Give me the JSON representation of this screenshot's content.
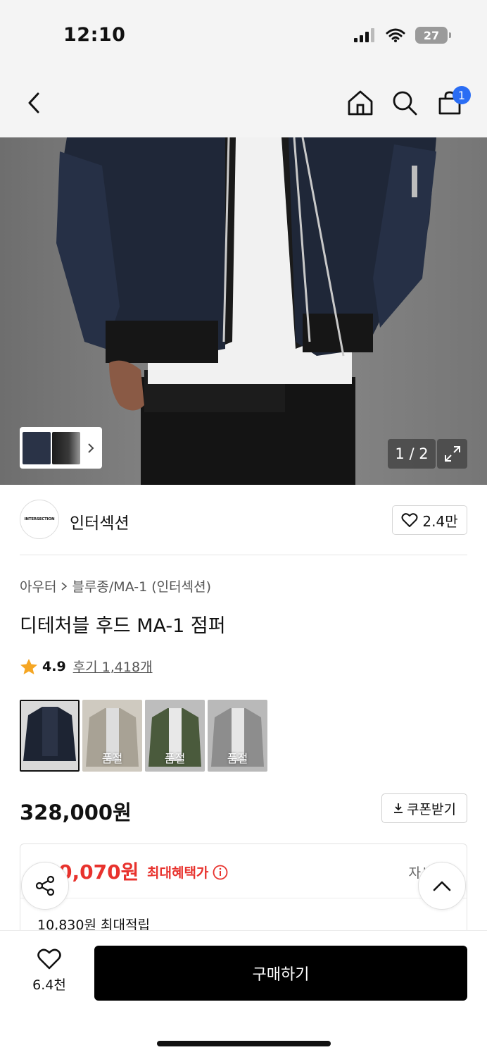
{
  "status": {
    "time": "12:10",
    "battery": "27"
  },
  "nav": {
    "cart_count": "1"
  },
  "hero": {
    "page_counter": "1 / 2"
  },
  "brand": {
    "logo_text": "INTERSECTION",
    "name": "인터섹션",
    "likes": "2.4만"
  },
  "breadcrumb": {
    "category": "아우터",
    "subcategory": "블루종/MA-1 (인터섹션)"
  },
  "product": {
    "title": "디테처블 후드 MA-1 점퍼",
    "rating": "4.9",
    "reviews": "후기 1,418개",
    "price": "328,000원",
    "coupon_label": "쿠폰받기"
  },
  "swatches": [
    {
      "color": "#1d2433",
      "soldout": ""
    },
    {
      "color": "#a8a295",
      "soldout": "품절"
    },
    {
      "color": "#4a5a3c",
      "soldout": "품절"
    },
    {
      "color": "#8d8d8d",
      "soldout": "품절"
    }
  ],
  "benefit": {
    "price": "0,070원",
    "label": "최대혜택가",
    "detail": "자세히",
    "points": "10,830원 최대적립"
  },
  "bottom": {
    "likes": "6.4천",
    "buy_label": "구매하기"
  },
  "colors": {
    "accent_red": "#e8322d",
    "badge_blue": "#2a6df4",
    "star": "#f5a623"
  }
}
